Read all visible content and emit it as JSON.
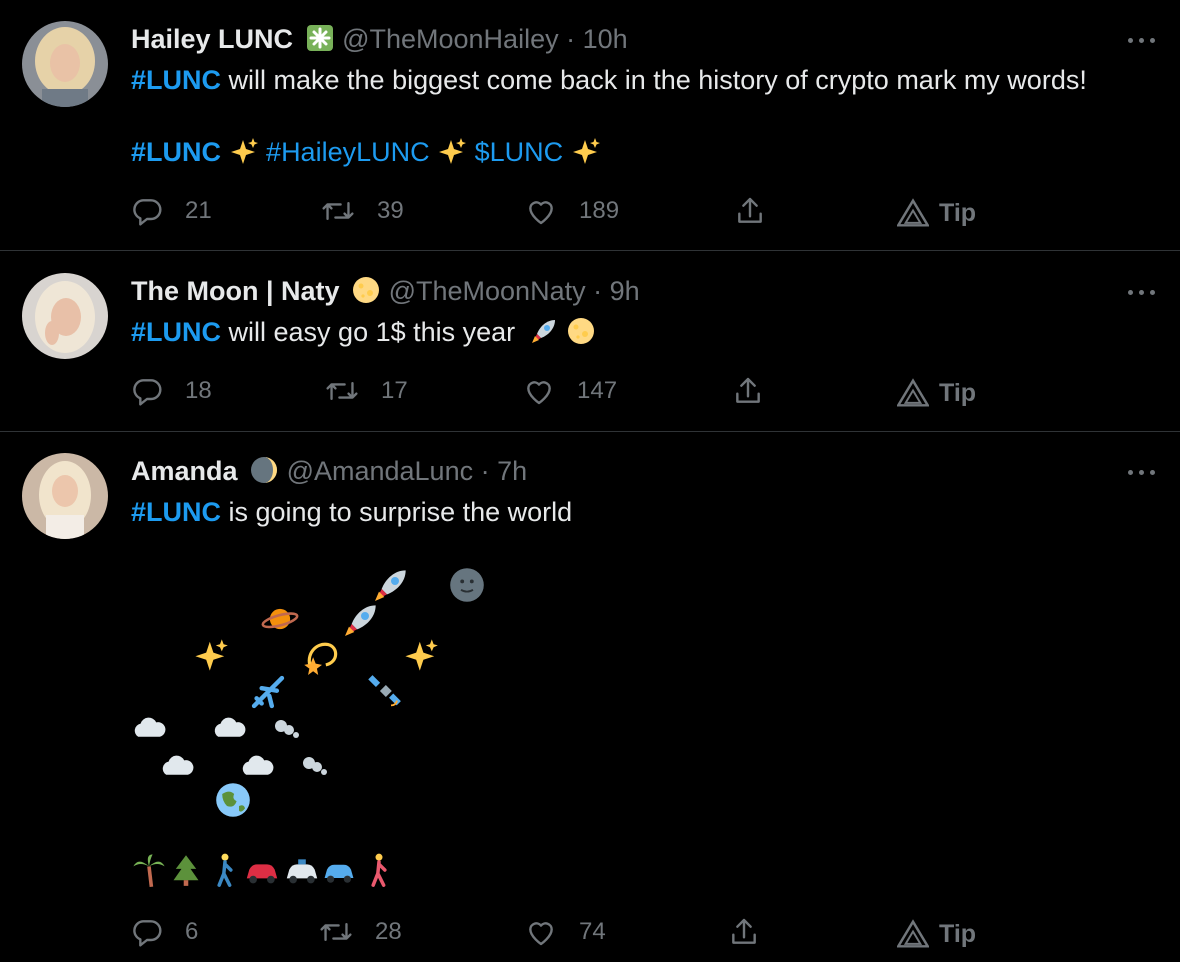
{
  "tweets": [
    {
      "name": "Hailey LUNC",
      "badge_icon": "sparkle-green-icon",
      "handle": "@TheMoonHailey",
      "separator": "·",
      "time": "10h",
      "line1_tag": "#LUNC",
      "line1_text": " will make the biggest come back in the history of crypto mark my words!",
      "tags": [
        "#LUNC",
        "#HaileyLUNC",
        "$LUNC"
      ],
      "replies": "21",
      "retweets": "39",
      "likes": "189",
      "tip": "Tip"
    },
    {
      "name": "The Moon | Naty",
      "badge_icon": "full-moon-icon",
      "handle": "@TheMoonNaty",
      "separator": "·",
      "time": "9h",
      "line1_tag": "#LUNC",
      "line1_text": " will easy go 1$ this year",
      "replies": "18",
      "retweets": "17",
      "likes": "147",
      "tip": "Tip"
    },
    {
      "name": "Amanda",
      "badge_icon": "waning-moon-icon",
      "handle": "@AmandaLunc",
      "separator": "·",
      "time": "7h",
      "line1_tag": "#LUNC",
      "line1_text": " is going to surprise the world",
      "replies": "6",
      "retweets": "28",
      "likes": "74",
      "tip": "Tip"
    }
  ],
  "colors": {
    "background": "#000000",
    "text": "#e7e9ea",
    "muted": "#71767b",
    "link": "#1d9bf0",
    "divider": "#2f3336"
  }
}
